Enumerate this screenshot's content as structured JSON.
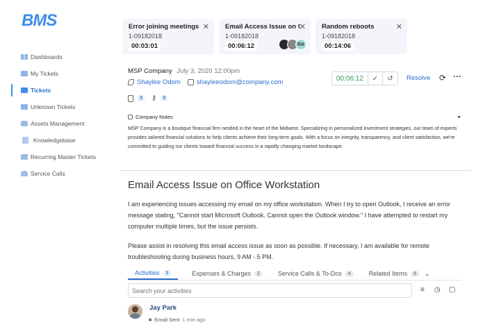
{
  "app": {
    "logo": "BMS"
  },
  "sidebar": {
    "items": [
      {
        "label": "Dashboards",
        "icon": "dashboard-icon"
      },
      {
        "label": "My Tickets",
        "icon": "ticket-icon"
      },
      {
        "label": "Tickets",
        "icon": "ticket-icon",
        "active": true
      },
      {
        "label": "Unknown Tickets",
        "icon": "ticket-icon"
      },
      {
        "label": "Assets Management",
        "icon": "box-icon"
      },
      {
        "label": "Knowledgebase",
        "icon": "book-icon"
      },
      {
        "label": "Recurring Master Tickets",
        "icon": "recurring-icon"
      },
      {
        "label": "Service Calls",
        "icon": "phone-icon"
      }
    ]
  },
  "ticket_tabs": [
    {
      "title": "Error joining meetings",
      "number": "1-09182018",
      "timer": "00:03:01"
    },
    {
      "title": "Email Access Issue on Office Workstation",
      "number": "1-09182018",
      "timer": "00:06:12"
    },
    {
      "title": "Random reboots",
      "number": "1-09182018",
      "timer": "00:14:06"
    }
  ],
  "viewers": {
    "third_initials": "RA"
  },
  "ticket": {
    "company": "MSP Company",
    "date": "July 3, 2020 12:00pm",
    "contact_name": "Shaylee Odom",
    "contact_email": "shayleeodom@company.com",
    "attachments_count": "3",
    "keys_count": "3",
    "timer": "00:06:12",
    "resolve_label": "Resolve",
    "subject": "Email Access Issue on Office Workstation",
    "description_1": "I am experiencing issues accessing my email on my office workstation. When I try to open Outlook, I receive an error message stating, \"Cannot start Microsoft Outlook. Cannot open the Outlook window.\" I have attempted to restart my computer multiple times, but the issue persists.",
    "description_2": "Please assist in resolving this email access issue as soon as possible. If necessary, I am available for remote troubleshooting during business hours, 9 AM - 5 PM."
  },
  "company_notes": {
    "title": "Company Notes",
    "text": "MSP Company is a boutique financial firm nestled in the heart of the Midwest. Specializing in personalized investment strategies, our team of experts provides tailored financial solutions to help clients achieve their long-term goals. With a focus on integrity, transparency, and client satisfaction, we're committed to guiding our clients toward financial success in a rapidly changing market landscape."
  },
  "activity_tabs": [
    {
      "label": "Activities",
      "count": "9"
    },
    {
      "label": "Expenses & Charges",
      "count": "2"
    },
    {
      "label": "Service Calls & To-Dos",
      "count": "4"
    },
    {
      "label": "Related Items",
      "count": "6"
    }
  ],
  "search": {
    "placeholder": "Search your activities"
  },
  "activity": {
    "name": "Jay Park",
    "type": "Email Sent",
    "time": "1 min ago"
  },
  "colors": {
    "accent": "#2b6ecf",
    "timer_green": "#2e9a52"
  }
}
